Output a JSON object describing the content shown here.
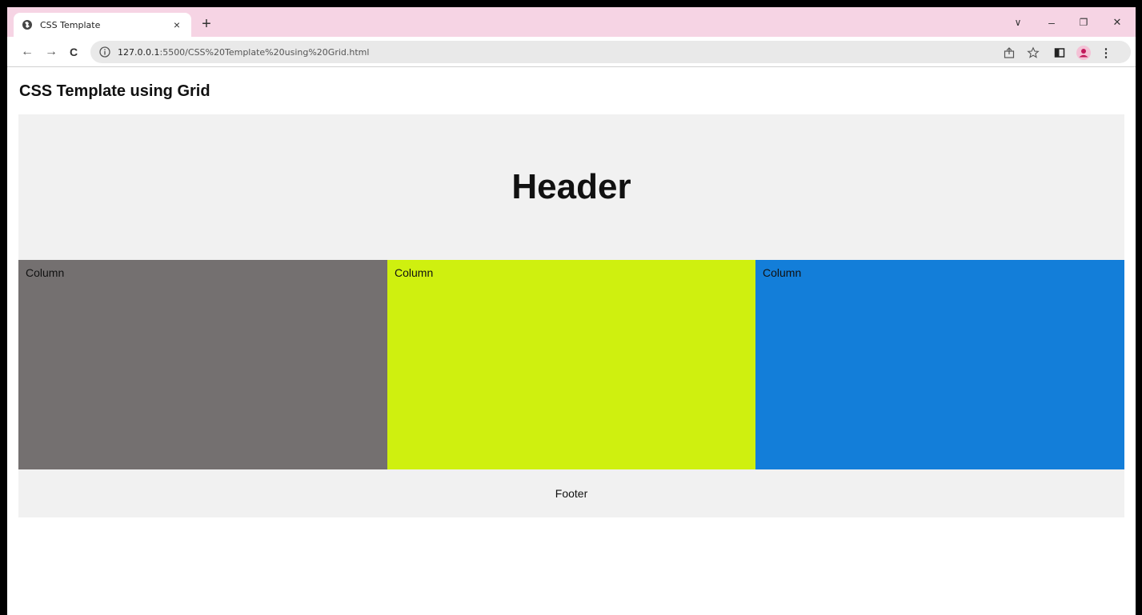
{
  "browser": {
    "tab": {
      "title": "CSS Template",
      "close": "×"
    },
    "new_tab": "+",
    "window_controls": {
      "tabs_menu": "∨",
      "minimize": "–",
      "restore": "❐",
      "close": "✕"
    },
    "nav": {
      "back": "←",
      "forward": "→",
      "reload": "C"
    },
    "address": {
      "host": "127.0.0.1",
      "rest": ":5500/CSS%20Template%20using%20Grid.html"
    },
    "colors": {
      "tab_strip": "#f6d4e4",
      "profile": "#c2185b"
    }
  },
  "page": {
    "title": "CSS Template using Grid",
    "header": "Header",
    "columns": [
      {
        "label": "Column",
        "color": "#747070"
      },
      {
        "label": "Column",
        "color": "#cff00f"
      },
      {
        "label": "Column",
        "color": "#137ed9"
      }
    ],
    "footer": "Footer"
  }
}
